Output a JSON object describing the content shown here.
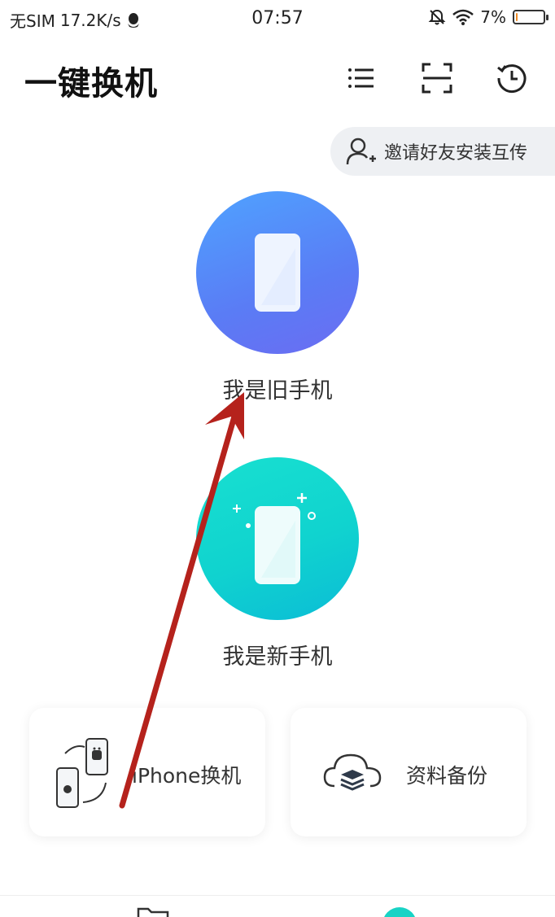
{
  "status_bar": {
    "carrier": "无SIM",
    "speed": "17.2K/s",
    "time": "07:57",
    "battery": "7%",
    "battery_level": 0.07
  },
  "header": {
    "title": "一键换机",
    "icons": [
      "list-icon",
      "scan-icon",
      "history-icon"
    ]
  },
  "invite": {
    "label": "邀请好友安装互传"
  },
  "actions": {
    "old_phone_label": "我是旧手机",
    "new_phone_label": "我是新手机"
  },
  "cards": {
    "iphone_label": "iPhone换机",
    "backup_label": "资料备份"
  },
  "colors": {
    "old_phone_gradient": [
      "#4fa3ff",
      "#6b6cf2"
    ],
    "new_phone_gradient": [
      "#18e0d0",
      "#0bbcd6"
    ],
    "annotation_arrow": "#b5221c",
    "accent": "#18d3c5"
  }
}
